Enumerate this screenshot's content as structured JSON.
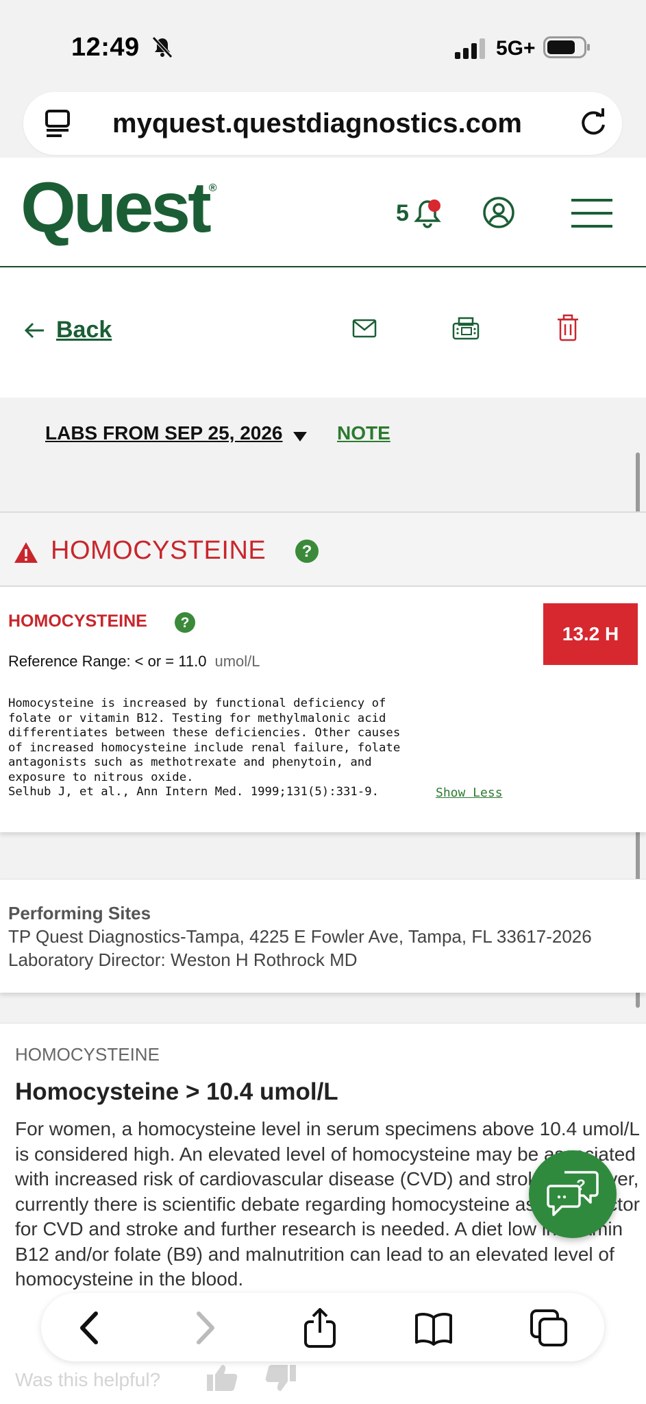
{
  "status_bar": {
    "time": "12:49",
    "network": "5G+"
  },
  "browser": {
    "url": "myquest.questdiagnostics.com"
  },
  "header": {
    "logo": "Quest",
    "logo_mark": "®",
    "notification_count": "5"
  },
  "actions": {
    "back_label": "Back"
  },
  "labs": {
    "date_label": "LABS FROM SEP 25, 2026",
    "note_label": "NOTE"
  },
  "section": {
    "title": "HOMOCYSTEINE"
  },
  "result": {
    "name": "HOMOCYSTEINE",
    "reference_range": "Reference Range: < or = 11.0",
    "unit": "umol/L",
    "value": "13.2 H",
    "flag_color": "#d7282f",
    "comment_lines": [
      "Homocysteine is increased by functional deficiency of",
      "folate or vitamin B12. Testing for methylmalonic acid",
      "differentiates between these deficiencies. Other causes",
      "of increased homocysteine include renal failure, folate",
      "antagonists such as methotrexate and phenytoin, and",
      "exposure to nitrous oxide.",
      "Selhub J, et al., Ann Intern Med. 1999;131(5):331-9."
    ],
    "show_less_label": "Show Less"
  },
  "performing_sites": {
    "title": "Performing Sites",
    "address": "TP Quest Diagnostics-Tampa, 4225 E Fowler Ave, Tampa, FL 33617-2026",
    "director": "Laboratory Director: Weston H Rothrock MD"
  },
  "info": {
    "kicker": "HOMOCYSTEINE",
    "heading": "Homocysteine > 10.4 umol/L",
    "body": "For women, a homocysteine level in serum specimens above 10.4 umol/L is considered high. An elevated level of homocysteine may be associated with increased risk of cardiovascular disease (CVD) and stroke. However, currently there is scientific debate regarding homocysteine as a risk factor for CVD and stroke and further research is needed. A diet low in vitamin B12 and/or folate (B9) and malnutrition can lead to an elevated level of homocysteine in the blood.",
    "helpful_label": "Was this helpful?"
  },
  "colors": {
    "brand_green": "#1b5e35",
    "link_green": "#2c7a2f",
    "alert_red": "#c8262c",
    "chat_green": "#2f8a3d"
  },
  "icons": [
    "bell-slash-icon",
    "signal-icon",
    "battery-icon",
    "tabs-icon",
    "reload-icon",
    "notification-bell-icon",
    "account-icon",
    "menu-icon",
    "arrow-left-icon",
    "mail-icon",
    "fax-icon",
    "trash-icon",
    "caret-down-icon",
    "warning-icon",
    "help-icon",
    "chat-icon",
    "thumbs-up-icon",
    "thumbs-down-icon",
    "chevron-left-icon",
    "chevron-right-icon",
    "share-icon",
    "book-icon",
    "tabs-overview-icon"
  ]
}
